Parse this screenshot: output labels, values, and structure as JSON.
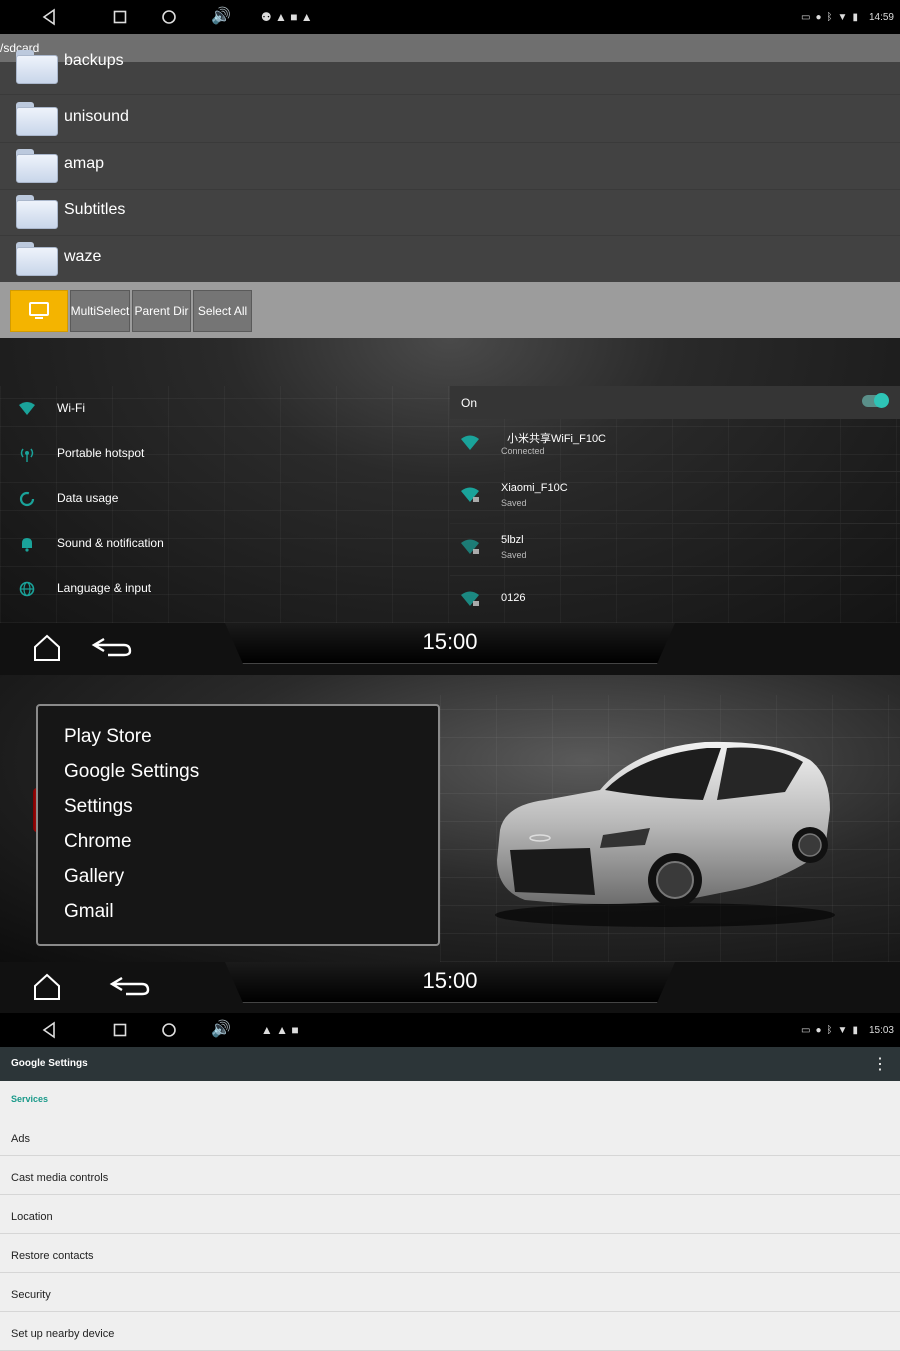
{
  "top_status": {
    "time": "14:59"
  },
  "file_browser": {
    "path": "/sdcard",
    "folders": [
      "backups",
      "unisound",
      "amap",
      "Subtitles",
      "waze"
    ],
    "toolbar": {
      "multiselect": "MultiSelect",
      "parent_dir": "Parent Dir",
      "select_all": "Select All"
    }
  },
  "settings_menu": {
    "items": [
      {
        "label": "Wi-Fi",
        "icon": "wifi-icon"
      },
      {
        "label": "Portable hotspot",
        "icon": "hotspot-icon"
      },
      {
        "label": "Data usage",
        "icon": "data-usage-icon"
      },
      {
        "label": "Sound & notification",
        "icon": "bell-icon"
      },
      {
        "label": "Language & input",
        "icon": "globe-icon"
      }
    ]
  },
  "wifi_panel": {
    "state": "On",
    "enabled": true,
    "networks": [
      {
        "name": "小米共享WiFi_F10C",
        "status": "Connected"
      },
      {
        "name": "Xiaomi_F10C",
        "status": "Saved"
      },
      {
        "name": "5lbzl",
        "status": "Saved"
      },
      {
        "name": "0126",
        "status": ""
      }
    ]
  },
  "car_bar_1": {
    "clock": "15:00"
  },
  "launcher": {
    "apps": [
      "Play Store",
      "Google Settings",
      "Settings",
      "Chrome",
      "Gallery",
      "Gmail"
    ]
  },
  "car_bar_2": {
    "clock": "15:00"
  },
  "bottom_status": {
    "time": "15:03"
  },
  "google_settings": {
    "title": "Google Settings",
    "section": "Services",
    "items": [
      "Ads",
      "Cast media controls",
      "Location",
      "Restore contacts",
      "Security",
      "Set up nearby device"
    ]
  },
  "colors": {
    "accent_teal": "#1aa39a",
    "toolbar_active": "#f4b400",
    "section_green": "#1b9a8a"
  }
}
